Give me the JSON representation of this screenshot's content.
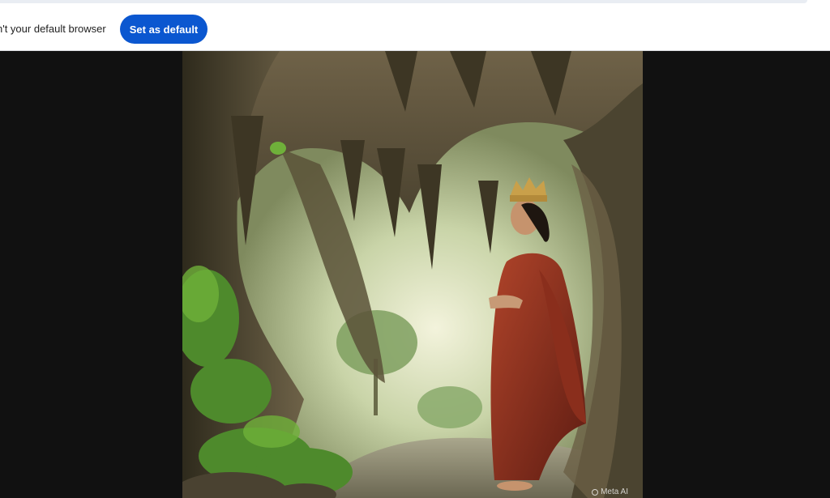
{
  "infobar": {
    "message": "n't your default browser",
    "button_label": "Set as default"
  },
  "image": {
    "watermark": "Meta AI",
    "watermark_icon": "ring-icon"
  },
  "colors": {
    "accent": "#0b57d0",
    "viewer_background": "#111111"
  }
}
